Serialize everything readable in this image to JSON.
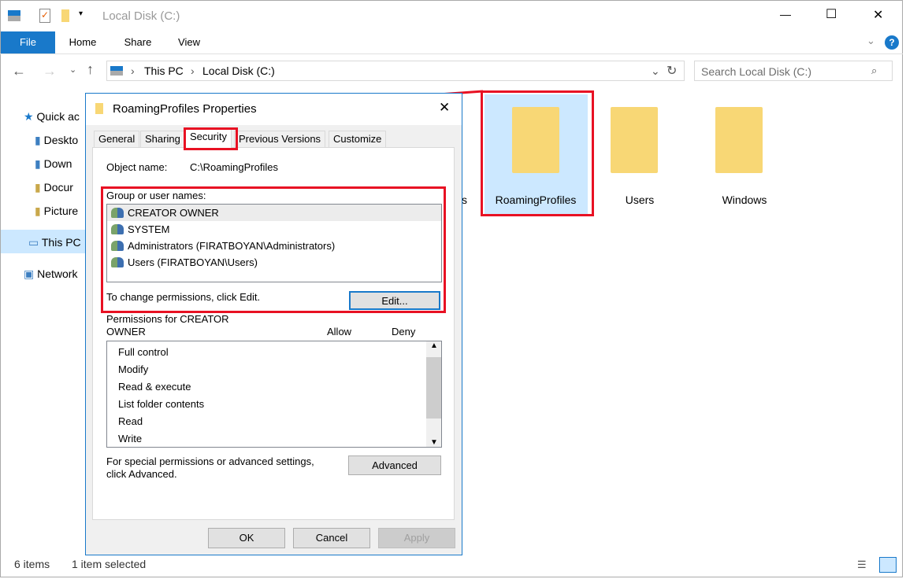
{
  "window": {
    "title": "Local Disk (C:)",
    "controls": {
      "minimize": "—",
      "maximize": "☐",
      "close": "✕"
    }
  },
  "ribbon": {
    "tabs": [
      "File",
      "Home",
      "Share",
      "View"
    ]
  },
  "address": {
    "crumbs": [
      "This PC",
      "Local Disk (C:)"
    ],
    "search_placeholder": "Search Local Disk (C:)"
  },
  "nav": {
    "items": [
      "Quick ac",
      "Deskto",
      "Down",
      "Docur",
      "Picture",
      "This PC",
      "Network"
    ]
  },
  "content": {
    "partial_label": "s",
    "folders": [
      {
        "name": "RoamingProfiles",
        "selected": true
      },
      {
        "name": "Users"
      },
      {
        "name": "Windows"
      }
    ]
  },
  "status": {
    "items": "6 items",
    "selected": "1 item selected"
  },
  "dialog": {
    "title": "RoamingProfiles Properties",
    "tabs": [
      "General",
      "Sharing",
      "Security",
      "Previous Versions",
      "Customize"
    ],
    "active_tab": "Security",
    "object_label": "Object name:",
    "object_value": "C:\\RoamingProfiles",
    "group_label": "Group or user names:",
    "users": [
      "CREATOR OWNER",
      "SYSTEM",
      "Administrators (FIRATBOYAN\\Administrators)",
      "Users (FIRATBOYAN\\Users)"
    ],
    "change_text": "To change permissions, click Edit.",
    "edit": "Edit...",
    "perm_label_1": "Permissions for CREATOR",
    "perm_label_2": "OWNER",
    "allow": "Allow",
    "deny": "Deny",
    "permissions": [
      "Full control",
      "Modify",
      "Read & execute",
      "List folder contents",
      "Read",
      "Write"
    ],
    "special_1": "For special permissions or advanced settings,",
    "special_2": "click Advanced.",
    "advanced": "Advanced",
    "ok": "OK",
    "cancel": "Cancel",
    "apply": "Apply"
  },
  "colors": {
    "accent": "#1979ca",
    "highlight": "#e81123"
  }
}
